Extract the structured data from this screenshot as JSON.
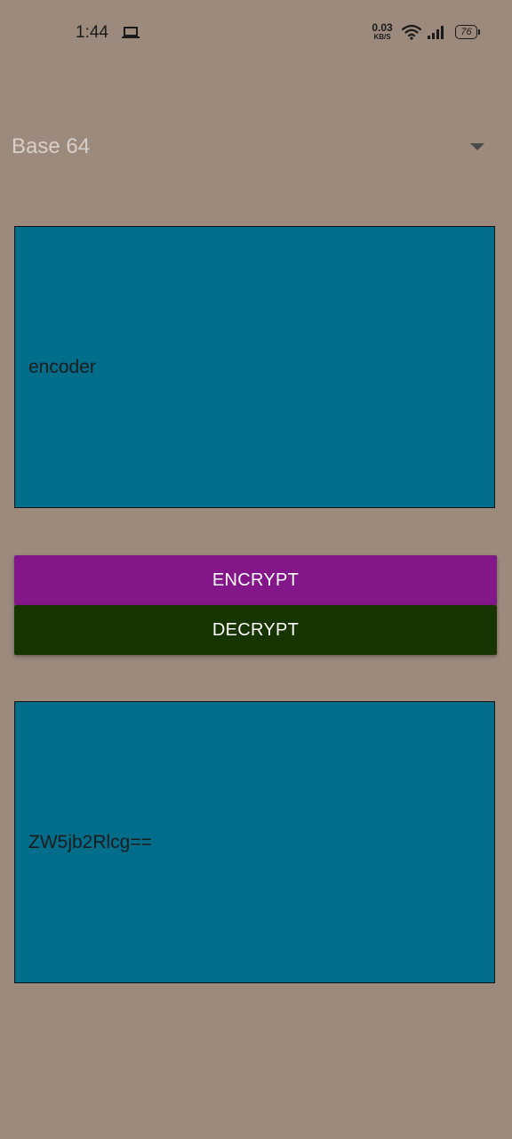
{
  "status_bar": {
    "time": "1:44",
    "net_speed_value": "0.03",
    "net_speed_unit": "KB/S",
    "battery_level": "76",
    "icons": [
      "laptop-icon",
      "wifi-icon",
      "signal-icon",
      "battery-icon"
    ]
  },
  "spinner": {
    "selected_value": "Base 64",
    "arrow_icon": "dropdown-arrow-icon"
  },
  "input_box": {
    "value": "encoder"
  },
  "buttons": {
    "encrypt_label": "ENCRYPT",
    "decrypt_label": "DECRYPT"
  },
  "output_box": {
    "value": "ZW5jb2Rlcg=="
  },
  "colors": {
    "background": "#9c8b7d",
    "text_box": "#006d8b",
    "encrypt_button": "#83178a",
    "decrypt_button": "#163500"
  }
}
